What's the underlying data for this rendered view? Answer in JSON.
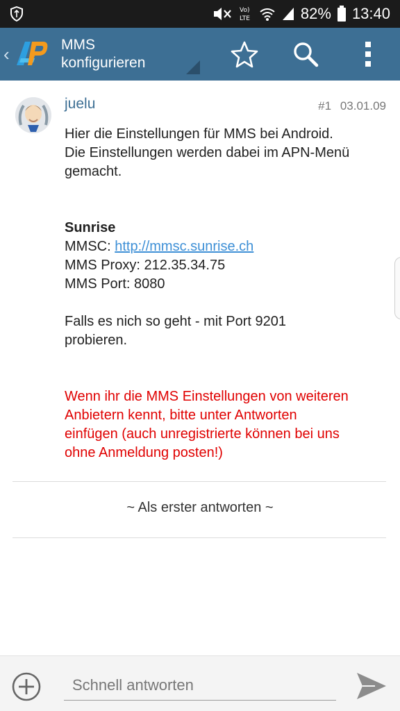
{
  "status_bar": {
    "battery": "82%",
    "time": "13:40",
    "network": "LTE",
    "icons": [
      "shield-icon",
      "mute-icon",
      "volte-icon",
      "wifi-icon",
      "signal-icon",
      "battery-icon"
    ]
  },
  "app_bar": {
    "title_line1": "MMS",
    "title_line2": "konfigurieren",
    "color": "#3d6f94",
    "actions": [
      "star-icon",
      "search-icon",
      "overflow-menu-icon"
    ]
  },
  "post": {
    "author": "juelu",
    "number": "#1",
    "date": "03.01.09",
    "intro_line1": "Hier die Einstellungen für MMS bei Android.",
    "intro_line2": "Die Einstellungen werden dabei im APN-Menü",
    "intro_line3": "gemacht.",
    "provider": "Sunrise",
    "mmsc_label": "MMSC: ",
    "mmsc_url": "http://mmsc.sunrise.ch",
    "proxy": "MMS Proxy: 212.35.34.75",
    "port": "MMS Port: 8080",
    "fallback_line1": "Falls es nich so geht - mit Port 9201",
    "fallback_line2": "probieren.",
    "notice_line1": "Wenn ihr die MMS Einstellungen von weiteren",
    "notice_line2": "Anbietern kennt, bitte unter Antworten",
    "notice_line3": "einfügen (auch unregistrierte können bei uns",
    "notice_line4": "ohne Anmeldung posten!)",
    "notice_color": "#e00000"
  },
  "reply_first": "~ Als erster antworten ~",
  "bottom_bar": {
    "placeholder": "Schnell antworten"
  }
}
